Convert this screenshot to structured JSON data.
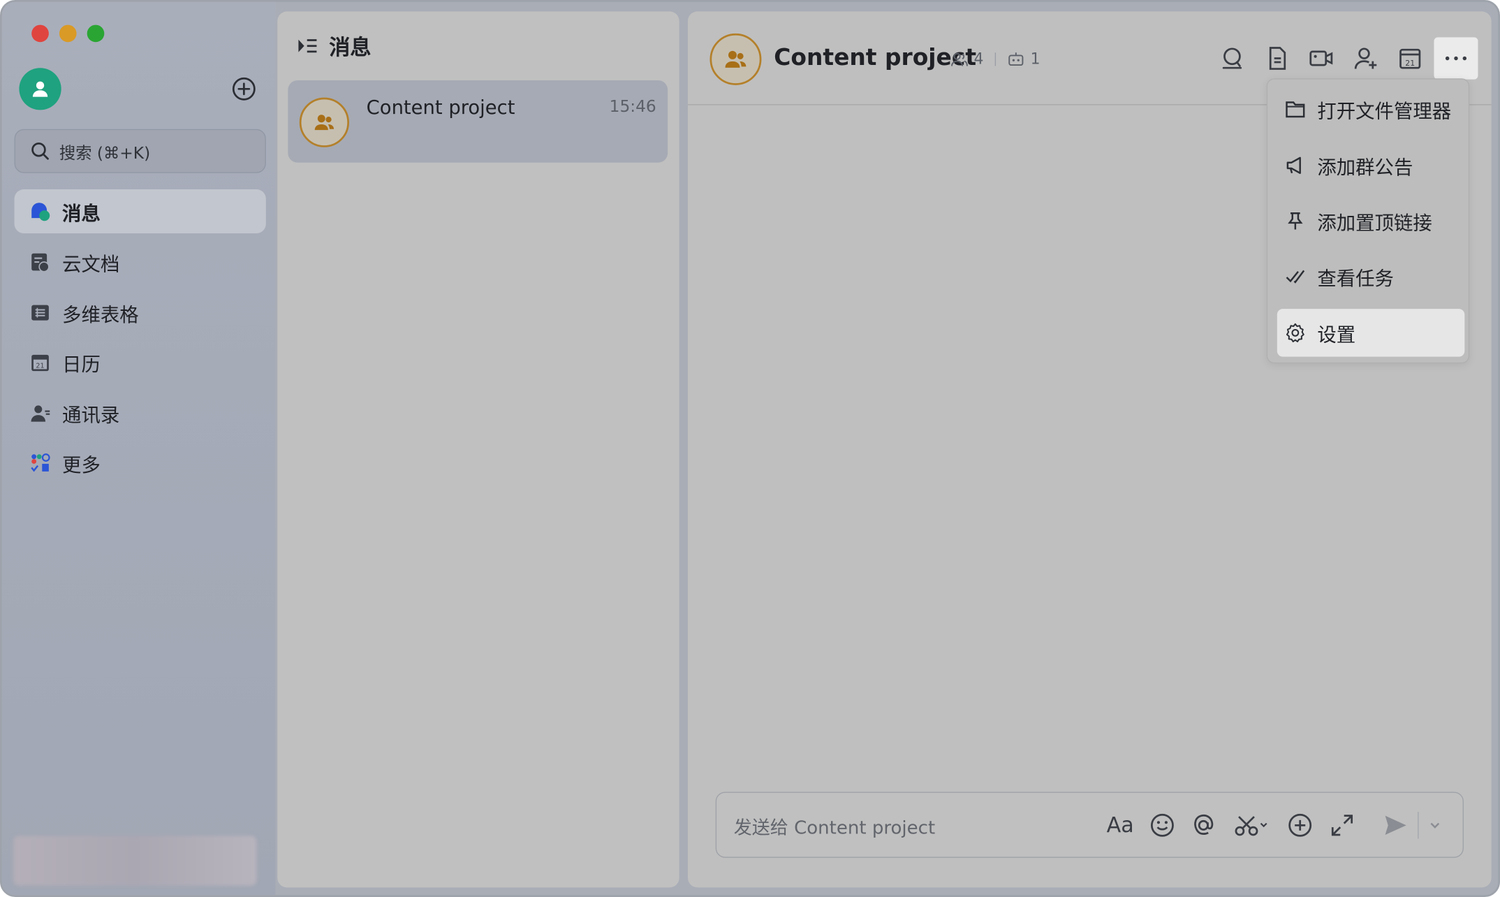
{
  "sidebar": {
    "search_placeholder": "搜索 (⌘+K)",
    "items": [
      {
        "label": "消息",
        "icon": "messages-icon",
        "active": true
      },
      {
        "label": "云文档",
        "icon": "cloud-docs-icon"
      },
      {
        "label": "多维表格",
        "icon": "base-table-icon"
      },
      {
        "label": "日历",
        "icon": "calendar-icon"
      },
      {
        "label": "通讯录",
        "icon": "contacts-icon"
      },
      {
        "label": "更多",
        "icon": "more-apps-icon"
      }
    ]
  },
  "message_list": {
    "title": "消息",
    "conversations": [
      {
        "name": "Content project",
        "time": "15:46"
      }
    ]
  },
  "chat": {
    "title": "Content project",
    "member_count": "4",
    "bot_count": "1",
    "composer_placeholder": "发送给 Content project",
    "format_label": "Aa"
  },
  "menu": {
    "items": [
      {
        "label": "打开文件管理器",
        "icon": "folder-icon"
      },
      {
        "label": "添加群公告",
        "icon": "megaphone-icon"
      },
      {
        "label": "添加置顶链接",
        "icon": "pin-icon"
      },
      {
        "label": "查看任务",
        "icon": "task-check-icon"
      },
      {
        "label": "设置",
        "icon": "gear-icon",
        "highlighted": true
      }
    ]
  },
  "colors": {
    "accent_green": "#1fa27f",
    "group_avatar_border": "#b4802a",
    "menu_highlight": "#e6e6e6"
  }
}
